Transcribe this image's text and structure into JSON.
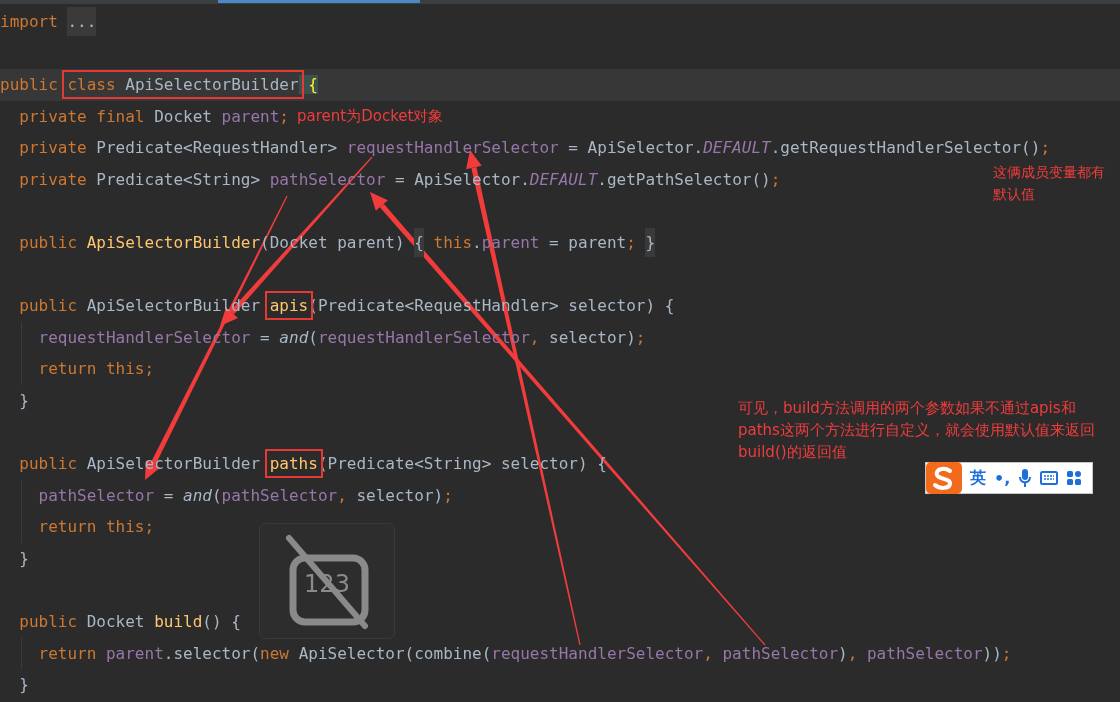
{
  "code_lines": [
    {
      "kind": "code",
      "current": false,
      "guide": false,
      "tokens": [
        {
          "text": "import ",
          "kind": "kw"
        },
        {
          "text": "...",
          "kind": "fold"
        }
      ]
    },
    {
      "kind": "blank",
      "current": false,
      "guide": false
    },
    {
      "kind": "code",
      "current": true,
      "guide": false,
      "tokens": [
        {
          "text": "public ",
          "kind": "kw"
        },
        {
          "kind": "boxed",
          "parts": [
            {
              "text": "class",
              "kind": "kw"
            },
            {
              "text": " ApiSelectorBuilder",
              "kind": "plain"
            }
          ]
        },
        {
          "text": " {",
          "kind": "brace"
        }
      ]
    },
    {
      "kind": "code",
      "current": false,
      "guide": false,
      "note": "parent为Docket对象",
      "tokens": [
        {
          "text": "  private final",
          "kind": "kw"
        },
        {
          "text": " Docket ",
          "kind": "plain"
        },
        {
          "text": "parent",
          "kind": "field"
        },
        {
          "text": ";",
          "kind": "kw"
        }
      ]
    },
    {
      "kind": "code",
      "current": false,
      "guide": false,
      "tokens": [
        {
          "text": "  private",
          "kind": "kw"
        },
        {
          "text": " Predicate<RequestHandler> ",
          "kind": "plain"
        },
        {
          "text": "requestHandlerSelector",
          "kind": "field"
        },
        {
          "text": " = ApiSelector.",
          "kind": "plain"
        },
        {
          "text": "DEFAULT",
          "kind": "static"
        },
        {
          "text": ".getRequestHandlerSelector()",
          "kind": "plain"
        },
        {
          "text": ";",
          "kind": "kw"
        }
      ]
    },
    {
      "kind": "code",
      "current": false,
      "guide": false,
      "tokens": [
        {
          "text": "  private",
          "kind": "kw"
        },
        {
          "text": " Predicate<String> ",
          "kind": "plain"
        },
        {
          "text": "pathSelector",
          "kind": "field"
        },
        {
          "text": " = ApiSelector.",
          "kind": "plain"
        },
        {
          "text": "DEFAULT",
          "kind": "static"
        },
        {
          "text": ".getPathSelector()",
          "kind": "plain"
        },
        {
          "text": ";",
          "kind": "kw"
        }
      ]
    },
    {
      "kind": "blank",
      "current": false,
      "guide": false
    },
    {
      "kind": "code",
      "current": false,
      "guide": false,
      "tokens": [
        {
          "text": "  public ",
          "kind": "kw"
        },
        {
          "text": "ApiSelectorBuilder",
          "kind": "method"
        },
        {
          "text": "(Docket parent) ",
          "kind": "plain"
        },
        {
          "text": "{",
          "kind": "fold"
        },
        {
          "text": " this",
          "kind": "kw"
        },
        {
          "text": ".",
          "kind": "plain"
        },
        {
          "text": "parent",
          "kind": "field"
        },
        {
          "text": " = parent",
          "kind": "plain"
        },
        {
          "text": "; ",
          "kind": "kw"
        },
        {
          "text": "}",
          "kind": "fold"
        }
      ]
    },
    {
      "kind": "blank",
      "current": false,
      "guide": false
    },
    {
      "kind": "code",
      "current": false,
      "guide": false,
      "tokens": [
        {
          "text": "  public",
          "kind": "kw"
        },
        {
          "text": " ApiSelectorBuilder ",
          "kind": "plain"
        },
        {
          "kind": "boxed",
          "parts": [
            {
              "text": "apis",
              "kind": "method"
            }
          ]
        },
        {
          "text": "(Predicate<RequestHandler> selector) {",
          "kind": "plain"
        }
      ]
    },
    {
      "kind": "code",
      "current": false,
      "guide": true,
      "tokens": [
        {
          "text": "    requestHandlerSelector",
          "kind": "field"
        },
        {
          "text": " = ",
          "kind": "plain"
        },
        {
          "text": "and",
          "kind": "italic"
        },
        {
          "text": "(",
          "kind": "plain"
        },
        {
          "text": "requestHandlerSelector",
          "kind": "field"
        },
        {
          "text": ",",
          "kind": "kw"
        },
        {
          "text": " selector)",
          "kind": "plain"
        },
        {
          "text": ";",
          "kind": "kw"
        }
      ]
    },
    {
      "kind": "code",
      "current": false,
      "guide": true,
      "tokens": [
        {
          "text": "    return this;",
          "kind": "kw"
        }
      ]
    },
    {
      "kind": "code",
      "current": false,
      "guide": false,
      "tokens": [
        {
          "text": "  }",
          "kind": "plain"
        }
      ]
    },
    {
      "kind": "blank",
      "current": false,
      "guide": false
    },
    {
      "kind": "code",
      "current": false,
      "guide": false,
      "tokens": [
        {
          "text": "  public",
          "kind": "kw"
        },
        {
          "text": " ApiSelectorBuilder ",
          "kind": "plain"
        },
        {
          "kind": "boxed",
          "parts": [
            {
              "text": "paths",
              "kind": "method"
            }
          ]
        },
        {
          "text": "(Predicate<String> selector) {",
          "kind": "plain"
        }
      ]
    },
    {
      "kind": "code",
      "current": false,
      "guide": true,
      "tokens": [
        {
          "text": "    pathSelector",
          "kind": "field"
        },
        {
          "text": " = ",
          "kind": "plain"
        },
        {
          "text": "and",
          "kind": "italic"
        },
        {
          "text": "(",
          "kind": "plain"
        },
        {
          "text": "pathSelector",
          "kind": "field"
        },
        {
          "text": ",",
          "kind": "kw"
        },
        {
          "text": " selector)",
          "kind": "plain"
        },
        {
          "text": ";",
          "kind": "kw"
        }
      ]
    },
    {
      "kind": "code",
      "current": false,
      "guide": true,
      "tokens": [
        {
          "text": "    return this;",
          "kind": "kw"
        }
      ]
    },
    {
      "kind": "code",
      "current": false,
      "guide": false,
      "tokens": [
        {
          "text": "  }",
          "kind": "plain"
        }
      ]
    },
    {
      "kind": "blank",
      "current": false,
      "guide": false
    },
    {
      "kind": "code",
      "current": false,
      "guide": false,
      "tokens": [
        {
          "text": "  public",
          "kind": "kw"
        },
        {
          "text": " Docket ",
          "kind": "plain"
        },
        {
          "text": "build",
          "kind": "method"
        },
        {
          "text": "() {",
          "kind": "plain"
        }
      ]
    },
    {
      "kind": "code",
      "current": false,
      "guide": true,
      "tokens": [
        {
          "text": "    return ",
          "kind": "kw"
        },
        {
          "text": "parent",
          "kind": "field"
        },
        {
          "text": ".selector(",
          "kind": "plain"
        },
        {
          "text": "new",
          "kind": "kw"
        },
        {
          "text": " ApiSelector(combine(",
          "kind": "plain"
        },
        {
          "text": "requestHandlerSelector",
          "kind": "field"
        },
        {
          "text": ", ",
          "kind": "kw"
        },
        {
          "text": "pathSelector",
          "kind": "field"
        },
        {
          "text": ")",
          "kind": "plain"
        },
        {
          "text": ", ",
          "kind": "kw"
        },
        {
          "text": "pathSelector",
          "kind": "field"
        },
        {
          "text": "))",
          "kind": "plain"
        },
        {
          "text": ";",
          "kind": "kw"
        }
      ]
    },
    {
      "kind": "code",
      "current": false,
      "guide": false,
      "tokens": [
        {
          "text": "  }",
          "kind": "plain"
        }
      ]
    }
  ],
  "annotations": [
    {
      "kind": "side",
      "lines": [
        "这俩成员变量都有",
        "默认值"
      ]
    },
    {
      "kind": "summary",
      "lines": [
        "可见，build方法调用的两个参数如果不通过apis和",
        "paths这两个方法进行自定义，就会使用默认值来返回",
        "build()的返回值"
      ]
    }
  ],
  "input_mode_overlay": {
    "label": "123"
  },
  "ime_toolbar": {
    "language": "英",
    "punctuation": "•,"
  }
}
